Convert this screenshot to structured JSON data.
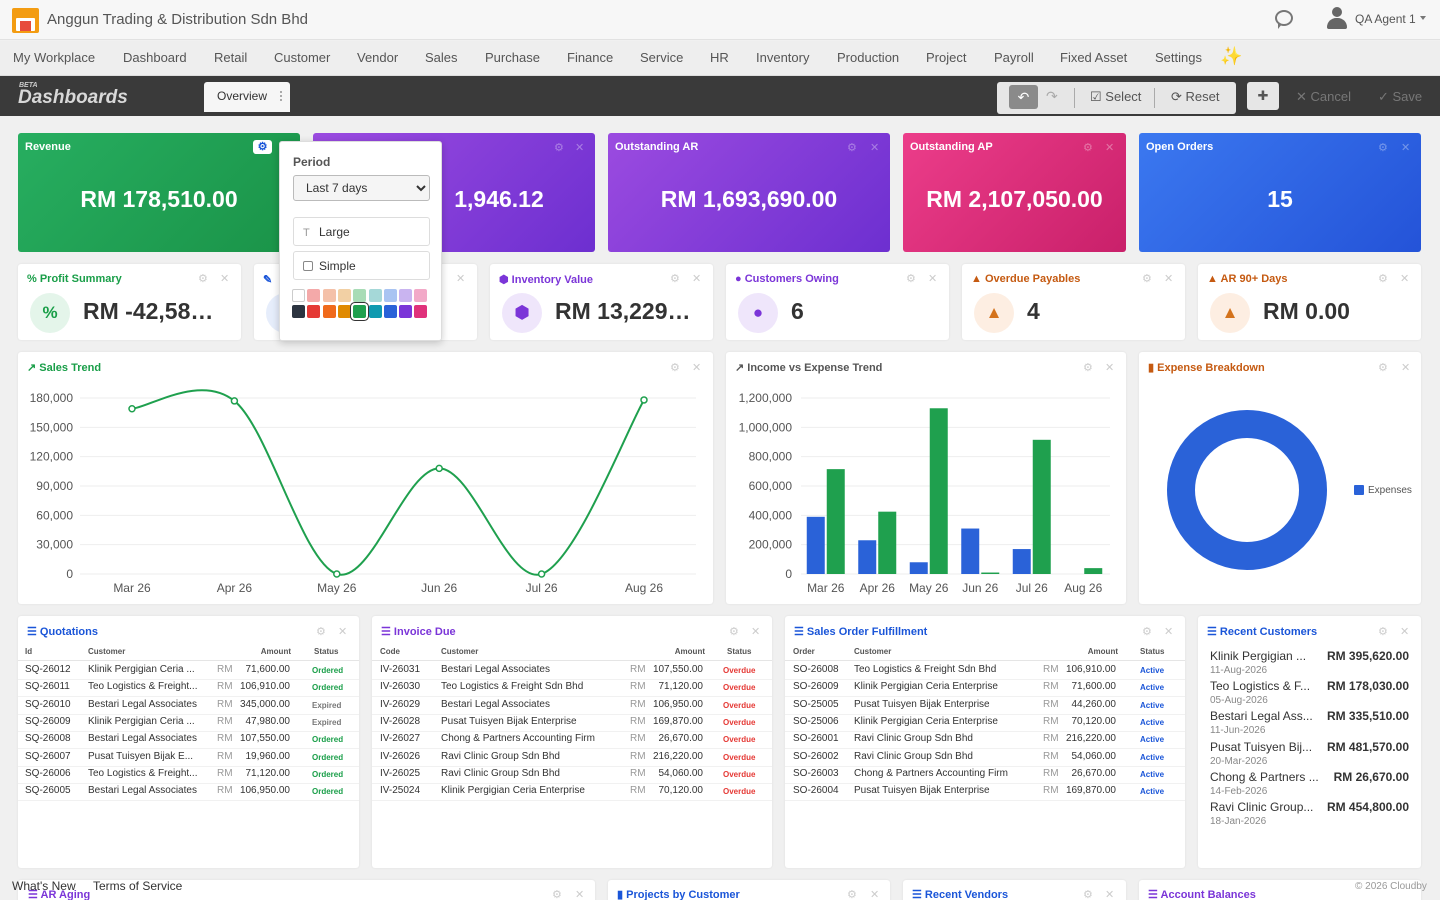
{
  "header": {
    "company": "Anggun Trading & Distribution Sdn Bhd",
    "user": "QA Agent 1"
  },
  "menu": [
    "My Workplace",
    "Dashboard",
    "Retail",
    "Customer",
    "Vendor",
    "Sales",
    "Purchase",
    "Finance",
    "Service",
    "HR",
    "Inventory",
    "Production",
    "Project",
    "Payroll",
    "Fixed Asset",
    "Settings"
  ],
  "dashbar": {
    "beta": "BETA",
    "title": "Dashboards",
    "tab": "Overview",
    "select": "Select",
    "reset": "Reset",
    "cancel": "Cancel",
    "save": "Save"
  },
  "kpis": [
    {
      "title": "Revenue",
      "value": "RM 178,510.00",
      "color": "#1fa04e"
    },
    {
      "title": "",
      "value": "1,946.12",
      "color": "#8a3ad8"
    },
    {
      "title": "Outstanding AR",
      "value": "RM 1,693,690.00",
      "color": "#8a3ad8"
    },
    {
      "title": "Outstanding AP",
      "value": "RM 2,107,050.00",
      "color": "#e0317b"
    },
    {
      "title": "Open Orders",
      "value": "15",
      "color": "#2a5fe0"
    }
  ],
  "popup": {
    "label": "Period",
    "period": "Last 7 days",
    "size": "Large",
    "style": "Simple"
  },
  "minis": [
    {
      "title": "Profit Summary",
      "value": "RM -42,58…",
      "icon": "%",
      "color": "#199e48"
    },
    {
      "title": "",
      "value": "",
      "icon": "",
      "color": "#1a55d8"
    },
    {
      "title": "Inventory Value",
      "value": "RM 13,229…",
      "icon": "cubes-icon",
      "color": "#7b35d8"
    },
    {
      "title": "Customers Owing",
      "value": "6",
      "icon": "users-icon",
      "color": "#7b35d8"
    },
    {
      "title": "Overdue Payables",
      "value": "4",
      "icon": "warning-icon",
      "color": "#c55a11"
    },
    {
      "title": "AR 90+ Days",
      "value": "RM 0.00",
      "icon": "warning-icon",
      "color": "#c55a11"
    }
  ],
  "charts": {
    "sales_title": "Sales Trend",
    "income_title": "Income vs Expense Trend",
    "expense_title": "Expense Breakdown",
    "expense_legend": "Expenses"
  },
  "chart_data": [
    {
      "type": "line",
      "title": "Sales Trend",
      "categories": [
        "Mar 26",
        "Apr 26",
        "May 26",
        "Jun 26",
        "Jul 26",
        "Aug 26"
      ],
      "yticks": [
        "180,000",
        "150,000",
        "120,000",
        "90,000",
        "60,000",
        "30,000",
        "0"
      ],
      "ylim": [
        0,
        180000
      ],
      "series": [
        {
          "values": [
            169000,
            177000,
            0,
            108000,
            0,
            178000
          ],
          "color": "#1fa04e"
        }
      ]
    },
    {
      "type": "bar",
      "title": "Income vs Expense Trend",
      "categories": [
        "Mar 26",
        "Apr 26",
        "May 26",
        "Jun 26",
        "Jul 26",
        "Aug 26"
      ],
      "yticks": [
        "1,200,000",
        "1,000,000",
        "800,000",
        "600,000",
        "400,000",
        "200,000",
        "0"
      ],
      "ylim": [
        0,
        1200000
      ],
      "series": [
        {
          "values": [
            390000,
            230000,
            80000,
            310000,
            170000,
            0
          ],
          "color": "#2a62d8"
        },
        {
          "values": [
            715000,
            425000,
            1130000,
            10000,
            915000,
            40000
          ],
          "color": "#1fa04e"
        }
      ]
    },
    {
      "type": "pie",
      "title": "Expense Breakdown",
      "series": [
        {
          "name": "Expenses",
          "values": [
            100
          ],
          "color": "#2a62d8"
        }
      ]
    }
  ],
  "quotations": {
    "title": "Quotations",
    "headers": [
      "Id",
      "Customer",
      "Amount",
      "Status"
    ],
    "rows": [
      [
        "SQ-26012",
        "Klinik Pergigian Ceria ...",
        "RM",
        "71,600.00",
        "Ordered"
      ],
      [
        "SQ-26011",
        "Teo Logistics & Freight...",
        "RM",
        "106,910.00",
        "Ordered"
      ],
      [
        "SQ-26010",
        "Bestari Legal Associates",
        "RM",
        "345,000.00",
        "Expired"
      ],
      [
        "SQ-26009",
        "Klinik Pergigian Ceria ...",
        "RM",
        "47,980.00",
        "Expired"
      ],
      [
        "SQ-26008",
        "Bestari Legal Associates",
        "RM",
        "107,550.00",
        "Ordered"
      ],
      [
        "SQ-26007",
        "Pusat Tuisyen Bijak E...",
        "RM",
        "19,960.00",
        "Ordered"
      ],
      [
        "SQ-26006",
        "Teo Logistics & Freight...",
        "RM",
        "71,120.00",
        "Ordered"
      ],
      [
        "SQ-26005",
        "Bestari Legal Associates",
        "RM",
        "106,950.00",
        "Ordered"
      ]
    ]
  },
  "invoices": {
    "title": "Invoice Due",
    "headers": [
      "Code",
      "Customer",
      "Amount",
      "Status"
    ],
    "rows": [
      [
        "IV-26031",
        "Bestari Legal Associates",
        "RM",
        "107,550.00",
        "Overdue"
      ],
      [
        "IV-26030",
        "Teo Logistics & Freight Sdn Bhd",
        "RM",
        "71,120.00",
        "Overdue"
      ],
      [
        "IV-26029",
        "Bestari Legal Associates",
        "RM",
        "106,950.00",
        "Overdue"
      ],
      [
        "IV-26028",
        "Pusat Tuisyen Bijak Enterprise",
        "RM",
        "169,870.00",
        "Overdue"
      ],
      [
        "IV-26027",
        "Chong & Partners Accounting Firm",
        "RM",
        "26,670.00",
        "Overdue"
      ],
      [
        "IV-26026",
        "Ravi Clinic Group Sdn Bhd",
        "RM",
        "216,220.00",
        "Overdue"
      ],
      [
        "IV-26025",
        "Ravi Clinic Group Sdn Bhd",
        "RM",
        "54,060.00",
        "Overdue"
      ],
      [
        "IV-25024",
        "Klinik Pergigian Ceria Enterprise",
        "RM",
        "70,120.00",
        "Overdue"
      ]
    ]
  },
  "orders": {
    "title": "Sales Order Fulfillment",
    "headers": [
      "Order",
      "Customer",
      "Amount",
      "Status"
    ],
    "rows": [
      [
        "SO-26008",
        "Teo Logistics & Freight Sdn Bhd",
        "RM",
        "106,910.00",
        "Active"
      ],
      [
        "SO-26009",
        "Klinik Pergigian Ceria Enterprise",
        "RM",
        "71,600.00",
        "Active"
      ],
      [
        "SO-25005",
        "Pusat Tuisyen Bijak Enterprise",
        "RM",
        "44,260.00",
        "Active"
      ],
      [
        "SO-25006",
        "Klinik Pergigian Ceria Enterprise",
        "RM",
        "70,120.00",
        "Active"
      ],
      [
        "SO-26001",
        "Ravi Clinic Group Sdn Bhd",
        "RM",
        "216,220.00",
        "Active"
      ],
      [
        "SO-26002",
        "Ravi Clinic Group Sdn Bhd",
        "RM",
        "54,060.00",
        "Active"
      ],
      [
        "SO-26003",
        "Chong & Partners Accounting Firm",
        "RM",
        "26,670.00",
        "Active"
      ],
      [
        "SO-26004",
        "Pusat Tuisyen Bijak Enterprise",
        "RM",
        "169,870.00",
        "Active"
      ]
    ]
  },
  "recent_customers": {
    "title": "Recent Customers",
    "rows": [
      [
        "Klinik Pergigian ...",
        "11-Aug-2026",
        "RM 395,620.00"
      ],
      [
        "Teo Logistics & F...",
        "05-Aug-2026",
        "RM 178,030.00"
      ],
      [
        "Bestari Legal Ass...",
        "11-Jun-2026",
        "RM 335,510.00"
      ],
      [
        "Pusat Tuisyen Bij...",
        "20-Mar-2026",
        "RM 481,570.00"
      ],
      [
        "Chong & Partners ...",
        "14-Feb-2026",
        "RM 26,670.00"
      ],
      [
        "Ravi Clinic Group...",
        "18-Jan-2026",
        "RM 454,800.00"
      ]
    ]
  },
  "bottom": [
    "AR Aging",
    "Projects by Customer",
    "Recent Vendors",
    "Account Balances"
  ],
  "footer": {
    "whats_new": "What's New",
    "terms": "Terms of Service",
    "copyright": "© 2026 Cloudby"
  }
}
